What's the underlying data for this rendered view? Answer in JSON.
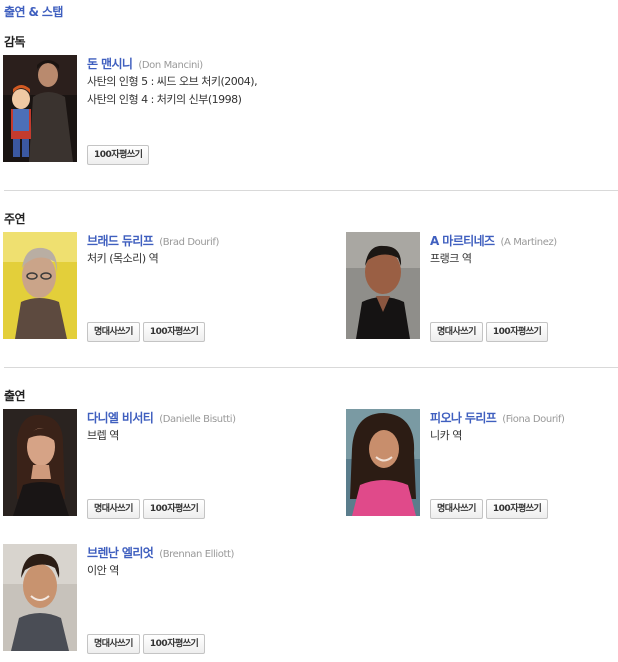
{
  "page_title": "출연 & 스탭",
  "buttons": {
    "line_label": "명대사쓰기",
    "review_label": "100자평쓰기"
  },
  "sections": [
    {
      "title": "감독",
      "people": [
        {
          "name": "돈 맨시니",
          "eng": "(Don Mancini)",
          "role": "사탄의 인형 5 : 씨드 오브 처키(2004), 사탄의 인형 4 : 처키의 신부(1998)",
          "photo": "man-with-doll-photo"
        }
      ]
    },
    {
      "title": "주연",
      "people": [
        {
          "name": "브래드 듀리프",
          "eng": "(Brad Dourif)",
          "role": "처키 (목소리) 역",
          "photo": "older-man-yellow-bg-photo"
        },
        {
          "name": "A 마르티네즈",
          "eng": "(A Martinez)",
          "role": "프랭크 역",
          "photo": "man-dark-shirt-photo"
        }
      ]
    },
    {
      "title": "출연",
      "people": [
        {
          "name": "다니엘 비서티",
          "eng": "(Danielle Bisutti)",
          "role": "브렙 역",
          "photo": "woman-dark-hair-photo"
        },
        {
          "name": "피오나 두리프",
          "eng": "(Fiona Dourif)",
          "role": "니카 역",
          "photo": "woman-curly-hair-photo"
        },
        {
          "name": "브렌난 엘리엇",
          "eng": "(Brennan Elliott)",
          "role": "이안 역",
          "photo": "man-smiling-photo"
        }
      ]
    }
  ],
  "colors": {
    "link": "#3f5fbf",
    "divider": "#d9d9d9",
    "muted": "#999999"
  }
}
